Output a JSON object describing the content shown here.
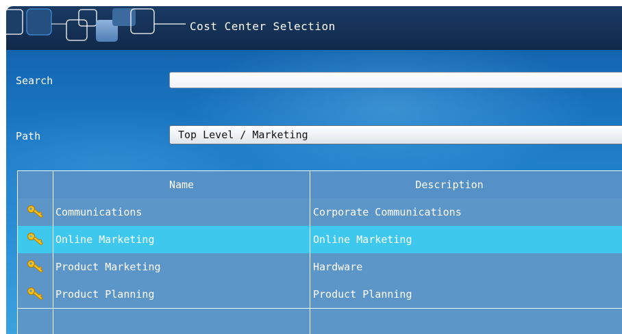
{
  "window": {
    "title": "Cost Center Selection"
  },
  "search": {
    "label": "Search",
    "value": "",
    "placeholder": ""
  },
  "path": {
    "label": "Path",
    "value": "Top Level / Marketing"
  },
  "table": {
    "columns": [
      "",
      "Name",
      "Description"
    ],
    "rows": [
      {
        "icon": "key-icon",
        "name": "Communications",
        "description": "Corporate Communications",
        "selected": false
      },
      {
        "icon": "key-icon",
        "name": "Online Marketing",
        "description": "Online Marketing",
        "selected": true
      },
      {
        "icon": "key-icon",
        "name": "Product Marketing",
        "description": "Hardware",
        "selected": false
      },
      {
        "icon": "key-icon",
        "name": "Product Planning",
        "description": "Product Planning",
        "selected": false
      }
    ]
  },
  "colors": {
    "titlebar": "#10294a",
    "background": "#1a76c2",
    "row": "#5c96c9",
    "selected_row": "#3ec8ee",
    "key_icon": "#f2c21b"
  }
}
